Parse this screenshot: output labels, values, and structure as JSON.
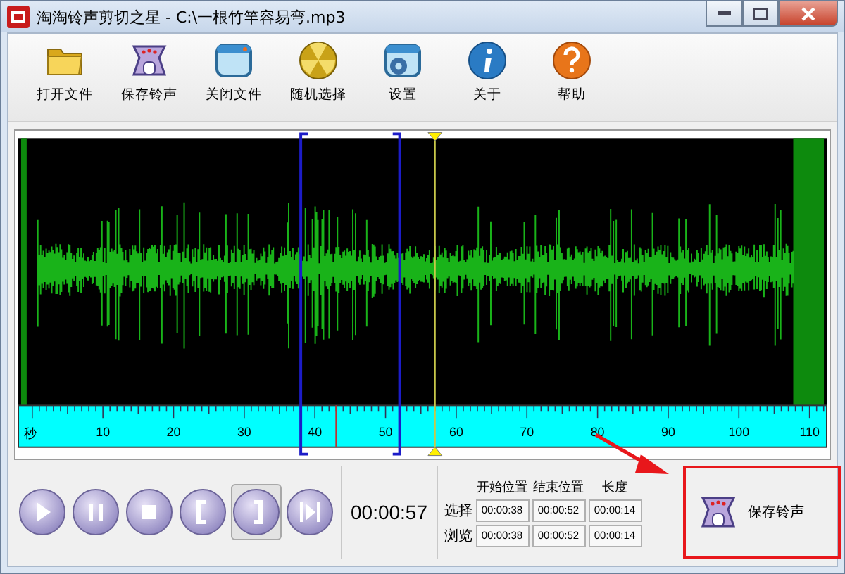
{
  "window": {
    "title": "淘淘铃声剪切之星 - C:\\一根竹竿容易弯.mp3"
  },
  "toolbar": [
    {
      "kind": "open",
      "label": "打开文件"
    },
    {
      "kind": "save",
      "label": "保存铃声"
    },
    {
      "kind": "close",
      "label": "关闭文件"
    },
    {
      "kind": "random",
      "label": "随机选择"
    },
    {
      "kind": "settings",
      "label": "设置"
    },
    {
      "kind": "about",
      "label": "关于"
    },
    {
      "kind": "help",
      "label": "帮助"
    }
  ],
  "ruler": {
    "unit": "秒",
    "labels": [
      "10",
      "20",
      "30",
      "40",
      "50",
      "60",
      "70",
      "80",
      "90",
      "100",
      "110"
    ]
  },
  "transport": [
    {
      "kind": "play",
      "selected": false
    },
    {
      "kind": "pause",
      "selected": false
    },
    {
      "kind": "stop",
      "selected": false
    },
    {
      "kind": "mark-start",
      "selected": false
    },
    {
      "kind": "mark-end",
      "selected": true
    },
    {
      "kind": "play-selection",
      "selected": false
    }
  ],
  "current_time": "00:00:57",
  "positions": {
    "columns": [
      "开始位置",
      "结束位置",
      "长度"
    ],
    "rows": [
      {
        "label": "选择",
        "values": [
          "00:00:38",
          "00:00:52",
          "00:00:14"
        ]
      },
      {
        "label": "浏览",
        "values": [
          "00:00:38",
          "00:00:52",
          "00:00:14"
        ]
      }
    ]
  },
  "save_button": {
    "label": "保存铃声",
    "highlighted": true
  }
}
